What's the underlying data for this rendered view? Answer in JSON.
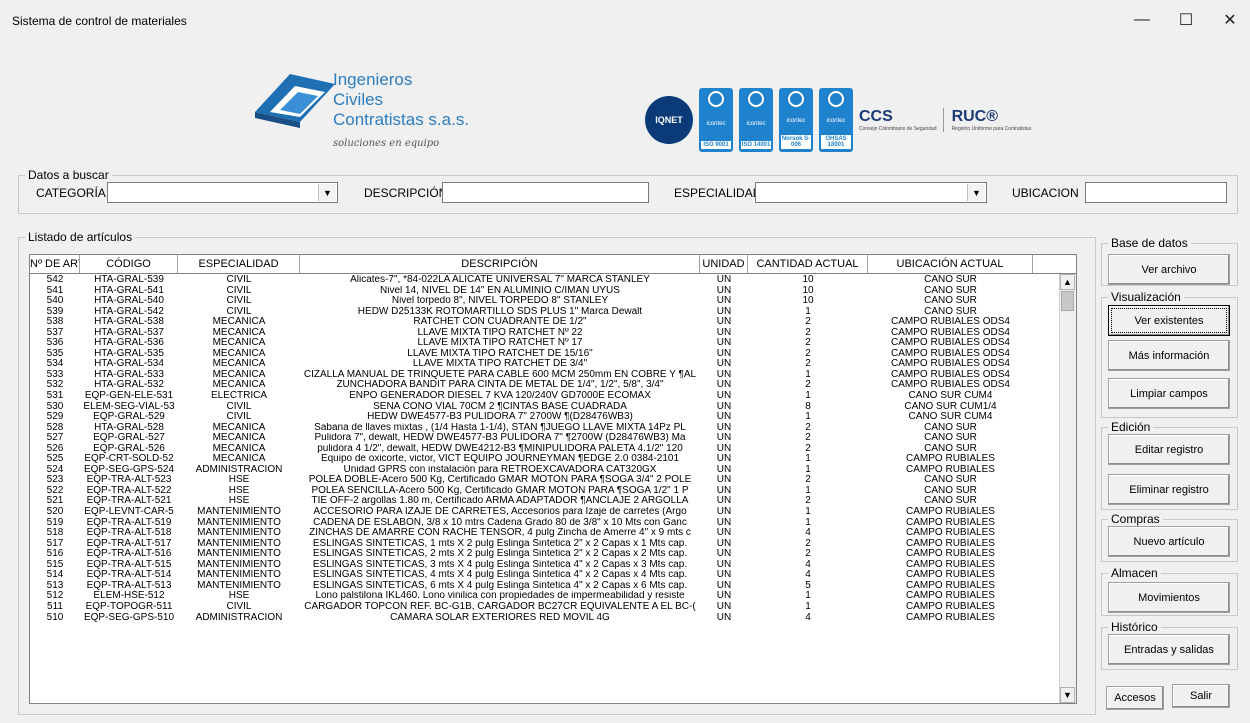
{
  "window": {
    "title": "Sistema de control de materiales",
    "minimize": "—",
    "maximize": "☐",
    "close": "✕"
  },
  "header": {
    "company_line1": "Ingenieros",
    "company_line2": "Civiles",
    "company_line3": "Contratistas s.a.s.",
    "tagline": "soluciones en equipo",
    "certs": {
      "iqnet": "IQNET",
      "icontec1": "icontec",
      "icontec2": "icontec",
      "icontec3": "icontec",
      "icontec4": "icontec",
      "std1": "ISO 9001",
      "std2": "ISO 14001",
      "std3": "Norsok S-006",
      "std4": "OHSAS 18001",
      "ccs": "CCS",
      "ccs_sub": "Consejo Colombiano de Seguridad",
      "ruc": "RUC®",
      "ruc_sub": "Registro Uniforme para Contratistas"
    }
  },
  "search": {
    "legend": "Datos a buscar",
    "categoria_label": "CATEGORÍA",
    "descripcion_label": "DESCRIPCIÓN",
    "especialidad_label": "ESPECIALIDAD",
    "ubicacion_label": "UBICACION",
    "categoria_value": "",
    "descripcion_value": "",
    "especialidad_value": "",
    "ubicacion_value": ""
  },
  "listing": {
    "legend": "Listado de artículos",
    "columns": [
      "Nº DE ART",
      "CÓDIGO",
      "ESPECIALIDAD",
      "DESCRIPCIÓN",
      "UNIDAD",
      "CANTIDAD ACTUAL",
      "UBICACIÓN ACTUAL"
    ],
    "rows": [
      [
        "542",
        "HTA-GRAL-539",
        "CIVIL",
        "Alicates-7\", *84-022LA ALICATE UNIVERSAL 7\" MARCA STANLEY",
        "UN",
        "10",
        "CAÑO SUR"
      ],
      [
        "541",
        "HTA-GRAL-541",
        "CIVIL",
        "Nivel 14, NIVEL DE 14\" EN ALUMINIO C/IMAN UYUS",
        "UN",
        "10",
        "CAÑO SUR"
      ],
      [
        "540",
        "HTA-GRAL-540",
        "CIVIL",
        "Nivel torpedo 8\", NIVEL TORPEDO 8\" STANLEY",
        "UN",
        "10",
        "CAÑO SUR"
      ],
      [
        "539",
        "HTA-GRAL-542",
        "CIVIL",
        "HEDW D25133K ROTOMARTILLO SDS PLUS 1\" Marca Dewalt",
        "UN",
        "1",
        "CAÑO SUR"
      ],
      [
        "538",
        "HTA-GRAL-538",
        "MECÁNICA",
        "RATCHET CON CUADRANTE DE 1/2\"",
        "UN",
        "2",
        "CAMPO RUBIALES ODS4"
      ],
      [
        "537",
        "HTA-GRAL-537",
        "MECÁNICA",
        "LLAVE MIXTA TIPO RATCHET Nº 22",
        "UN",
        "2",
        "CAMPO RUBIALES ODS4"
      ],
      [
        "536",
        "HTA-GRAL-536",
        "MECÁNICA",
        "LLAVE MIXTA TIPO RATCHET Nº 17",
        "UN",
        "2",
        "CAMPO RUBIALES ODS4"
      ],
      [
        "535",
        "HTA-GRAL-535",
        "MECÁNICA",
        "LLAVE MIXTA TIPO RATCHET DE 15/16\"",
        "UN",
        "2",
        "CAMPO RUBIALES ODS4"
      ],
      [
        "534",
        "HTA-GRAL-534",
        "MECÁNICA",
        "LLAVE MIXTA TIPO RATCHET DE 3/4\"",
        "UN",
        "2",
        "CAMPO RUBIALES ODS4"
      ],
      [
        "533",
        "HTA-GRAL-533",
        "MECÁNICA",
        "CIZALLA MANUAL DE TRINQUETE PARA CABLE 600 MCM 250mm EN COBRE Y ¶AL",
        "UN",
        "1",
        "CAMPO RUBIALES ODS4"
      ],
      [
        "532",
        "HTA-GRAL-532",
        "MECÁNICA",
        "ZUNCHADORA BANDIT PARA CINTA DE METAL DE 1/4\", 1/2\", 5/8\", 3/4\"",
        "UN",
        "2",
        "CAMPO RUBIALES ODS4"
      ],
      [
        "531",
        "EQP-GEN-ELE-531",
        "ELÉCTRICA",
        "ENPO GENERADOR DIESEL 7 KVA 120/240V GD7000E ECOMAX",
        "UN",
        "1",
        "CAÑO SUR CUM4"
      ],
      [
        "530",
        "ELEM-SEG-VIAL-53",
        "CIVIL",
        "SENA CONO VIAL 70CM 2 ¶CINTAS BASE CUADRADA",
        "UN",
        "8",
        "CAÑO SUR CUM1/4"
      ],
      [
        "529",
        "EQP-GRAL-529",
        "CIVIL",
        "HEDW DWE4577-B3 PULIDORA 7\" 2700W ¶(D28476WB3)",
        "UN",
        "1",
        "CAÑO SUR CUM4"
      ],
      [
        "528",
        "HTA-GRAL-528",
        "MECÁNICA",
        "Sabana de llaves mixtas , (1/4 Hasta 1-1/4), STAN ¶JUEGO LLAVE MIXTA 14Pz PL",
        "UN",
        "2",
        "CAÑO SUR"
      ],
      [
        "527",
        "EQP-GRAL-527",
        "MECÁNICA",
        "Pulidora 7\", dewalt, HEDW DWE4577-B3 PULIDORA 7\" ¶2700W (D28476WB3) Ma",
        "UN",
        "2",
        "CAÑO SUR"
      ],
      [
        "526",
        "EQP-GRAL-526",
        "MECÁNICA",
        "pulidora 4 1/2\", dewalt, HEDW DWE4212-B3 ¶MINIPULIDORA PALETA 4.1/2\" 120",
        "UN",
        "2",
        "CAÑO SUR"
      ],
      [
        "525",
        "EQP-CRT-SOLD-52",
        "MECÁNICA",
        "Equipo de oxicorte, victor, VICT EQUIPO JOURNEYMAN ¶EDGE 2.0 0384-2101",
        "UN",
        "1",
        "CAMPO RUBIALES"
      ],
      [
        "524",
        "EQP-SEG-GPS-524",
        "ADMINISTRACIÓN",
        "Unidad GPRS con instalación para RETROEXCAVADORA CAT320GX",
        "UN",
        "1",
        "CAMPO RUBIALES"
      ],
      [
        "523",
        "EQP-TRA-ALT-523",
        "HSE",
        "POLEA DOBLE-Acero 500 Kg, Certificado GMAR MOTON PARA ¶SOGA 3/4\" 2 POLE",
        "UN",
        "2",
        "CAÑO SUR"
      ],
      [
        "522",
        "EQP-TRA-ALT-522",
        "HSE",
        "POLEA SENCILLA-Acero 500 Kg, Certificado GMAR MOTON PARA ¶SOGA 1/2\" 1 P",
        "UN",
        "1",
        "CAÑO SUR"
      ],
      [
        "521",
        "EQP-TRA-ALT-521",
        "HSE",
        "TIE OFF-2 argollas 1.80 m, Certificado ARMA ADAPTADOR ¶ANCLAJE 2 ARGOLLA",
        "UN",
        "2",
        "CAÑO SUR"
      ],
      [
        "520",
        "EQP-LEVNT-CAR-5",
        "MANTENIMIENTO",
        "ACCESORIO PARA IZAJE DE CARRETES, Accesorios para Izaje de carretes (Argo",
        "UN",
        "1",
        "CAMPO RUBIALES"
      ],
      [
        "519",
        "EQP-TRA-ALT-519",
        "MANTENIMIENTO",
        "CADENA DE ESLABON, 3/8 x 10 mtrs Cadena Grado 80 de 3/8\" x 10 Mts con Ganc",
        "UN",
        "1",
        "CAMPO RUBIALES"
      ],
      [
        "518",
        "EQP-TRA-ALT-518",
        "MANTENIMIENTO",
        "ZINCHAS DE AMARRE CON RACHE TENSOR, 4 pulg Zincha de Amerre 4\" x 9 mts c",
        "UN",
        "4",
        "CAMPO RUBIALES"
      ],
      [
        "517",
        "EQP-TRA-ALT-517",
        "MANTENIMIENTO",
        "ESLINGAS SINTETICAS, 1 mts X 2 pulg Eslinga Sintetica 2\" x 2 Capas x 1 Mts cap.",
        "UN",
        "2",
        "CAMPO RUBIALES"
      ],
      [
        "516",
        "EQP-TRA-ALT-516",
        "MANTENIMIENTO",
        "ESLINGAS SINTETICAS, 2 mts X 2 pulg Eslinga Sintetica 2\" x 2 Capas x 2 Mts cap.",
        "UN",
        "2",
        "CAMPO RUBIALES"
      ],
      [
        "515",
        "EQP-TRA-ALT-515",
        "MANTENIMIENTO",
        "ESLINGAS SINTETICAS, 3 mts X 4 pulg Eslinga Sintetica 4\" x 2 Capas x 3 Mts cap.",
        "UN",
        "4",
        "CAMPO RUBIALES"
      ],
      [
        "514",
        "EQP-TRA-ALT-514",
        "MANTENIMIENTO",
        "ESLINGAS SINTETICAS, 4 mts X 4 pulg Eslinga Sintetica 4\" x 2 Capas x 4 Mts cap.",
        "UN",
        "4",
        "CAMPO RUBIALES"
      ],
      [
        "513",
        "EQP-TRA-ALT-513",
        "MANTENIMIENTO",
        "ESLINGAS SINTETICAS, 6 mts X 4 pulg Eslinga Sintetica 4\" x 2 Capas x 6 Mts cap.",
        "UN",
        "5",
        "CAMPO RUBIALES"
      ],
      [
        "512",
        "ELEM-HSE-512",
        "HSE",
        "Lono palstilona IKL460. Lono vinilica con propiedades de impermeabilidad y resiste",
        "UN",
        "1",
        "CAMPO RUBIALES"
      ],
      [
        "511",
        "EQP-TOPOGR-511",
        "CIVIL",
        "CARGADOR TOPCON REF. BC-G1B, CARGADOR BC27CR EQUIVALENTE A EL BC-(",
        "UN",
        "1",
        "CAMPO RUBIALES"
      ],
      [
        "510",
        "EQP-SEG-GPS-510",
        "ADMINISTRACIÓN",
        "CAMARA SOLAR EXTERIORES RED MOVIL 4G",
        "UN",
        "4",
        "CAMPO RUBIALES"
      ]
    ]
  },
  "sidebar": {
    "base_datos": {
      "legend": "Base de datos",
      "ver_archivo": "Ver archivo"
    },
    "visualizacion": {
      "legend": "Visualización",
      "ver_existentes": "Ver existentes",
      "mas_info": "Más información",
      "limpiar": "Limpiar campos"
    },
    "edicion": {
      "legend": "Edición",
      "editar": "Editar registro",
      "eliminar": "Eliminar registro"
    },
    "compras": {
      "legend": "Compras",
      "nuevo": "Nuevo artículo"
    },
    "almacen": {
      "legend": "Almacen",
      "movimientos": "Movimientos"
    },
    "historico": {
      "legend": "Histórico",
      "entradas": "Entradas y salidas"
    },
    "accesos": "Accesos",
    "salir": "Salir"
  }
}
